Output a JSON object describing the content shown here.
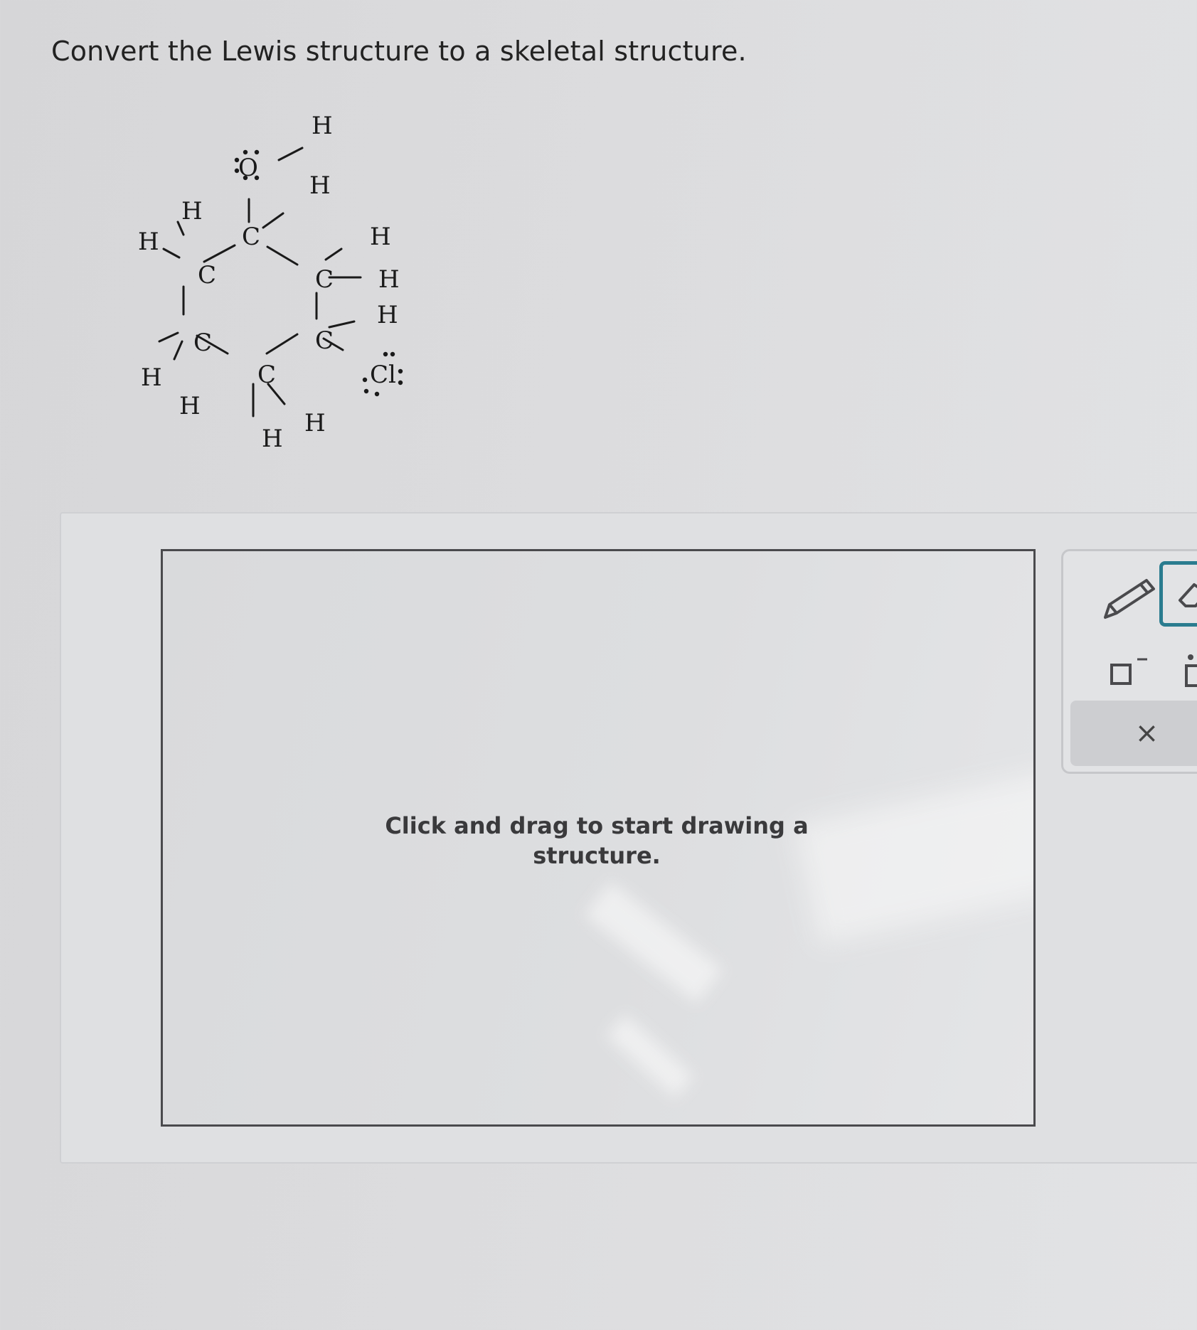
{
  "question": {
    "prompt": "Convert the Lewis structure to a skeletal structure."
  },
  "lewis_structure": {
    "atoms": {
      "oxygen": "O",
      "chlorine": "Cl",
      "carbon": "C",
      "hydrogen": "H"
    }
  },
  "drawing_area": {
    "hint_line1": "Click and drag to start drawing a",
    "hint_line2": "structure."
  },
  "toolbar": {
    "tools": [
      {
        "name": "pencil-icon"
      },
      {
        "name": "eraser-icon"
      },
      {
        "name": "charge-icon"
      },
      {
        "name": "lone-pair-icon"
      }
    ],
    "clear_label": "×"
  },
  "colors": {
    "accent": "#2a7c8f",
    "canvas_border": "#4a4a4d"
  }
}
